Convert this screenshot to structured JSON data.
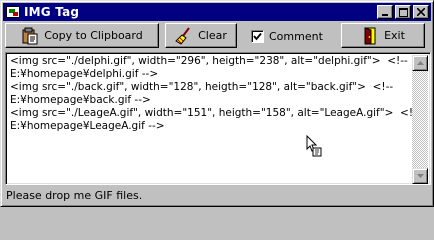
{
  "window": {
    "title": "IMG Tag"
  },
  "toolbar": {
    "copy_label": "Copy to Clipboard",
    "clear_label": "Clear",
    "comment_label": "Comment",
    "comment_checked": true,
    "exit_label": "Exit"
  },
  "editor": {
    "lines": [
      "<img src=\"./delphi.gif\", width=\"296\", heigth=\"238\", alt=\"delphi.gif\">  <!--",
      "E:¥homepage¥delphi.gif -->",
      "<img src=\"./back.gif\", width=\"128\", heigth=\"128\", alt=\"back.gif\">  <!--",
      "E:¥homepage¥back.gif -->",
      "<img src=\"./LeageA.gif\", width=\"151\", heigth=\"158\", alt=\"LeageA.gif\">  <!--",
      "E:¥homepage¥LeageA.gif -->"
    ]
  },
  "status": {
    "text": "Please drop me GIF files."
  },
  "colors": {
    "titlebar": "#000080",
    "face": "#c0c0c0"
  },
  "icons": {
    "app": "img-tag-app-icon",
    "copy": "clipboard-icon",
    "clear": "broom-icon",
    "exit": "door-exit-icon",
    "cursor": "drag-copy-cursor-icon"
  }
}
